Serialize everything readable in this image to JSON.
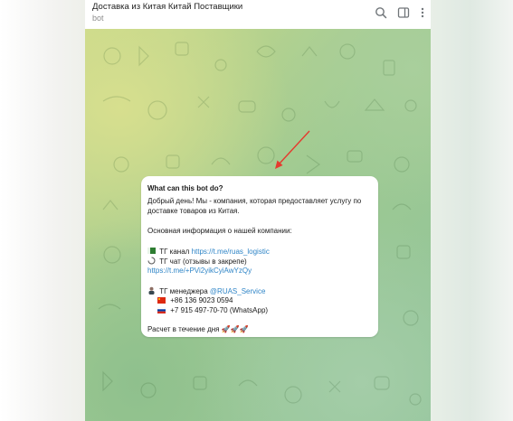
{
  "header": {
    "title": "Доставка из Китая Китай Поставщики",
    "subtitle": "bot",
    "icons": [
      "search-icon",
      "sidebar-toggle-icon",
      "more-vertical-icon"
    ]
  },
  "bot_info": {
    "heading": "What can this bot do?",
    "intro_line1": "Добрый день! Мы - компания, которая предоставляет услугу по",
    "intro_line2": "доставке товаров из Китая.",
    "main_info": "Основная информация о нашей компании:",
    "channel_label": "ТГ канал",
    "channel_link": "https://t.me/ruas_logistic",
    "chat_label": "ТГ чат (отзывы в закрепе)",
    "chat_link": "https://t.me/+PVi2yikCyiAwYzQy",
    "manager_label": "ТГ менеджера",
    "manager_handle": "@RUAS_Service",
    "phone_cn": "+86 136 9023 0594",
    "phone_ru": "+7 915 497-70-70 (WhatsApp)",
    "calc_text": "Расчет в течение дня",
    "rockets": "🚀🚀🚀"
  },
  "colors": {
    "link": "#2f85c7",
    "arrow": "#e53a2e",
    "header_bg": "#ffffff"
  }
}
